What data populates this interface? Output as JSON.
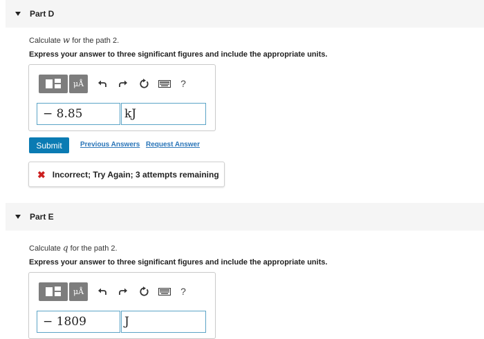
{
  "partD": {
    "title": "Part D",
    "question_prefix": "Calculate ",
    "question_var": "w",
    "question_suffix": " for the path 2.",
    "instruction": "Express your answer to three significant figures and include the appropriate units.",
    "units_button": "μÅ",
    "help": "?",
    "value": "− 8.85",
    "unit": "kJ",
    "submit": "Submit",
    "previous_answers": "Previous Answers",
    "request_answer": "Request Answer",
    "feedback_icon": "✖",
    "feedback": "Incorrect; Try Again; 3 attempts remaining"
  },
  "partE": {
    "title": "Part E",
    "question_prefix": "Calculate ",
    "question_var": "q",
    "question_suffix": " for the path 2.",
    "instruction": "Express your answer to three significant figures and include the appropriate units.",
    "units_button": "μÅ",
    "help": "?",
    "value": "− 1809",
    "unit": "J"
  },
  "icons": {
    "templates": "templates-icon",
    "units": "units-icon",
    "undo": "undo-icon",
    "redo": "redo-icon",
    "reset": "reset-icon",
    "keyboard": "keyboard-icon",
    "help": "help-icon"
  },
  "colors": {
    "accent": "#0a7bb3",
    "link": "#2a75b8",
    "error": "#cc1f1f",
    "field_border": "#5aa3c6",
    "toolbar_button": "#7d7d7d",
    "header_bg": "#f5f5f5"
  }
}
